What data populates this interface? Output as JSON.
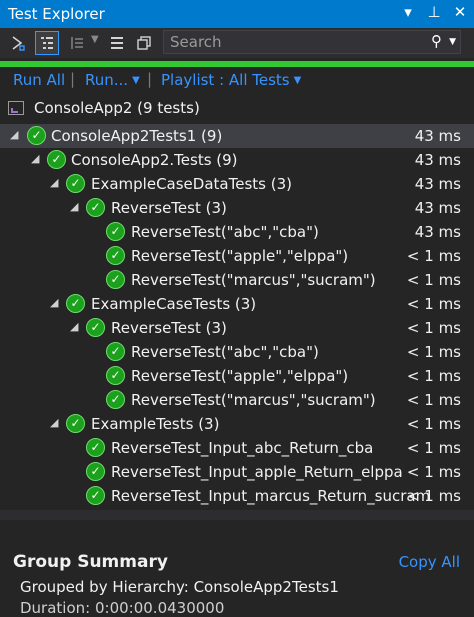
{
  "window": {
    "title": "Test Explorer",
    "controls": [
      "▾",
      "⊥",
      "✕"
    ]
  },
  "toolbar": {
    "search_placeholder": "Search"
  },
  "actions": {
    "run_all": "Run All",
    "run": "Run...",
    "playlist": "Playlist : All Tests"
  },
  "project": {
    "label": "ConsoleApp2 (9 tests)"
  },
  "tree": [
    {
      "label": "ConsoleApp2Tests1 (9)",
      "duration": "43 ms"
    },
    {
      "label": "ConsoleApp2.Tests (9)",
      "duration": "43 ms"
    },
    {
      "label": "ExampleCaseDataTests (3)",
      "duration": "43 ms"
    },
    {
      "label": "ReverseTest (3)",
      "duration": "43 ms"
    },
    {
      "label": "ReverseTest(\"abc\",\"cba\")",
      "duration": "43 ms"
    },
    {
      "label": "ReverseTest(\"apple\",\"elppa\")",
      "duration": "< 1 ms"
    },
    {
      "label": "ReverseTest(\"marcus\",\"sucram\")",
      "duration": "< 1 ms"
    },
    {
      "label": "ExampleCaseTests (3)",
      "duration": "< 1 ms"
    },
    {
      "label": "ReverseTest (3)",
      "duration": "< 1 ms"
    },
    {
      "label": "ReverseTest(\"abc\",\"cba\")",
      "duration": "< 1 ms"
    },
    {
      "label": "ReverseTest(\"apple\",\"elppa\")",
      "duration": "< 1 ms"
    },
    {
      "label": "ReverseTest(\"marcus\",\"sucram\")",
      "duration": "< 1 ms"
    },
    {
      "label": "ExampleTests (3)",
      "duration": "< 1 ms"
    },
    {
      "label": "ReverseTest_Input_abc_Return_cba",
      "duration": "< 1 ms"
    },
    {
      "label": "ReverseTest_Input_apple_Return_elppa",
      "duration": "< 1 ms"
    },
    {
      "label": "ReverseTest_Input_marcus_Return_sucram",
      "duration": "< 1 ms"
    }
  ],
  "summary": {
    "title": "Group Summary",
    "copy_all": "Copy All",
    "grouped_by": "Grouped by Hierarchy: ConsoleApp2Tests1",
    "duration": "Duration: 0:00:00.0430000"
  },
  "colors": {
    "accent": "#007acc",
    "pass": "#1ba11b",
    "progress": "#32c832",
    "link": "#3794ff"
  }
}
